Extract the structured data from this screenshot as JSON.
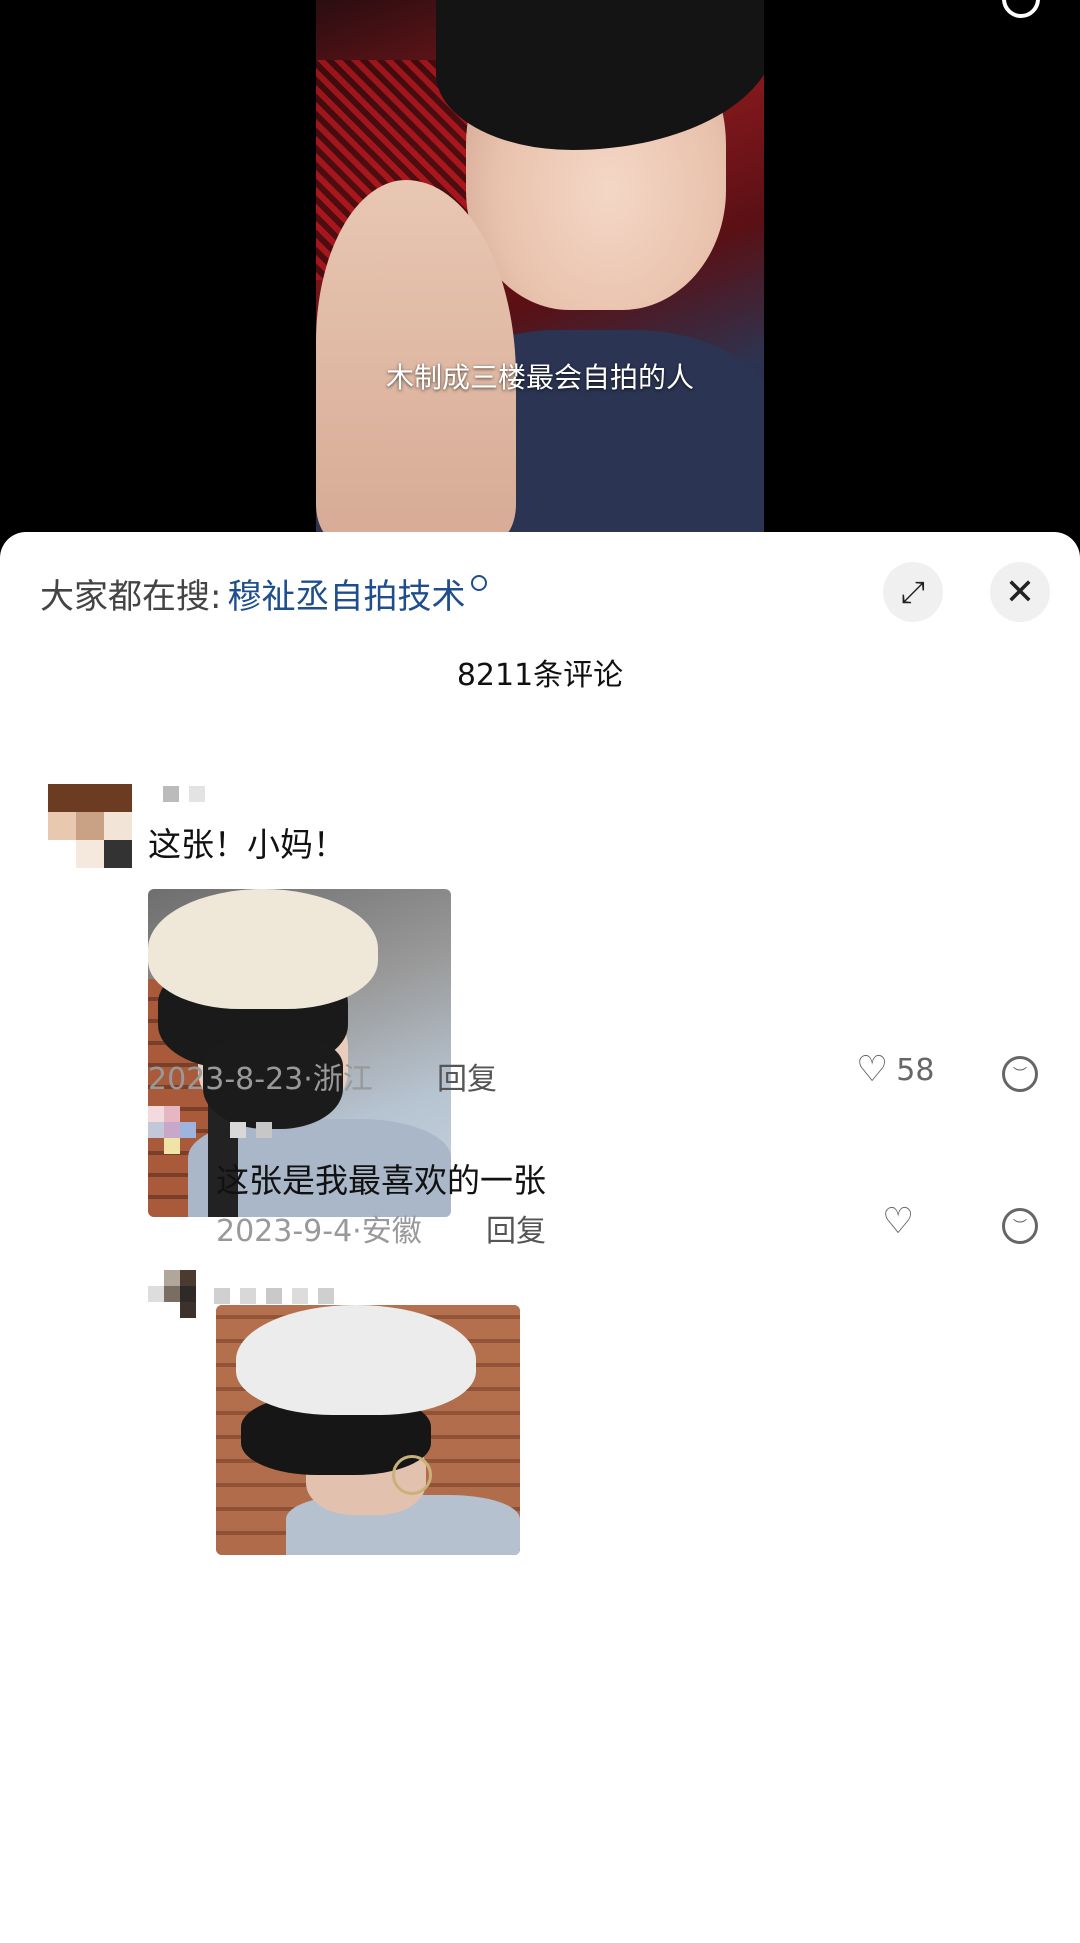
{
  "video": {
    "caption": "木制成三楼最会自拍的人"
  },
  "sheet": {
    "search_prefix": "大家都在搜:",
    "search_term": "穆祉丞自拍技术",
    "expand_icon": "⤢",
    "close_icon": "✕",
    "comment_count": "8211条评论"
  },
  "comments": [
    {
      "text": "这张！小妈！",
      "date_region": "2023-8-23·浙江",
      "reply_label": "回复",
      "likes": "58"
    },
    {
      "text": "这张是我最喜欢的一张",
      "date_region": "2023-9-4·安徽",
      "reply_label": "回复",
      "likes": ""
    }
  ],
  "icons": {
    "heart": "♡",
    "dislike": "︶"
  },
  "colors": {
    "link_blue": "#1f4e8c",
    "meta_gray": "#999999"
  }
}
